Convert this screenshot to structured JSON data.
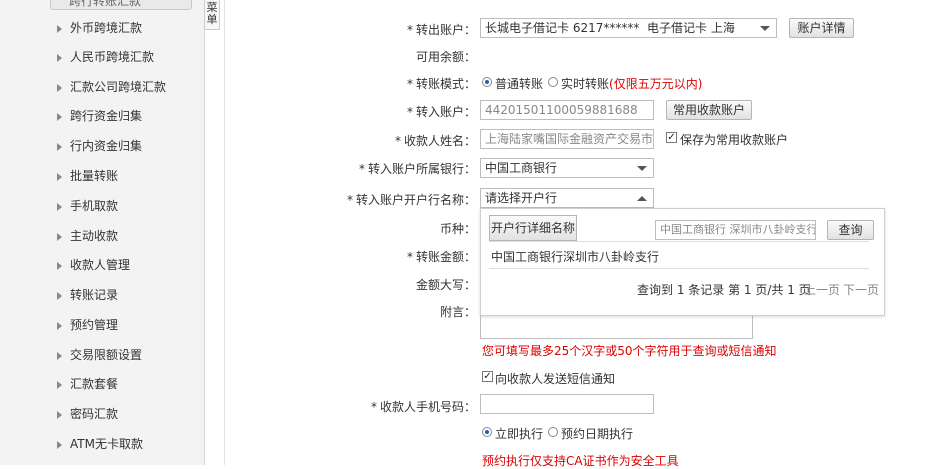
{
  "sidebar": {
    "top_item": "跨行转账汇款",
    "items": [
      {
        "label": "外币跨境汇款"
      },
      {
        "label": "人民币跨境汇款"
      },
      {
        "label": "汇款公司跨境汇款"
      },
      {
        "label": "跨行资金归集"
      },
      {
        "label": "行内资金归集"
      },
      {
        "label": "批量转账"
      },
      {
        "label": "手机取款"
      },
      {
        "label": "主动收款"
      },
      {
        "label": "收款人管理"
      },
      {
        "label": "转账记录"
      },
      {
        "label": "预约管理"
      },
      {
        "label": "交易限额设置"
      },
      {
        "label": "汇款套餐"
      },
      {
        "label": "密码汇款"
      },
      {
        "label": "ATM无卡取款"
      }
    ]
  },
  "menu_tab": "菜单",
  "form": {
    "required_mark": "*",
    "from_account": {
      "label": "转出账户：",
      "value": "长城电子借记卡 6217******",
      "value_suffix": "电子借记卡 上海",
      "button": "账户详情"
    },
    "balance": {
      "label": "可用余额："
    },
    "mode": {
      "label": "转账模式：",
      "option1": "普通转账",
      "option2": "实时转账",
      "option2_note": "(仅限五万元以内)"
    },
    "to_account": {
      "label": "转入账户：",
      "value": "44201501100059881688",
      "button": "常用收款账户"
    },
    "payee_name": {
      "label": "收款人姓名：",
      "value": "上海陆家嘴国际金融资产交易市场股份",
      "save_label": "保存为常用收款账户"
    },
    "bank": {
      "label": "转入账户所属银行：",
      "value": "中国工商银行"
    },
    "branch": {
      "label": "转入账户开户行名称：",
      "value": "请选择开户行"
    },
    "currency": {
      "label": "币种："
    },
    "amount": {
      "label": "转账金额："
    },
    "amount_upper": {
      "label": "金额大写："
    },
    "memo": {
      "label": "附言：",
      "hint": "您可填写最多25个汉字或50个字符用于查询或短信通知"
    },
    "sms": {
      "label": "向收款人发送短信通知"
    },
    "payee_phone": {
      "label": "收款人手机号码："
    },
    "exec": {
      "option1": "立即执行",
      "option2": "预约日期执行",
      "note": "预约执行仅支持CA证书作为安全工具"
    }
  },
  "dropdown": {
    "header": "开户行详细名称",
    "search_value": "中国工商银行 深圳市八卦岭支行",
    "search_button": "查询",
    "result": "中国工商银行深圳市八卦岭支行",
    "pager": {
      "text": "查询到 1 条记录  第 1 页/共 1 页",
      "prev": "上一页",
      "next": "下一页"
    }
  }
}
